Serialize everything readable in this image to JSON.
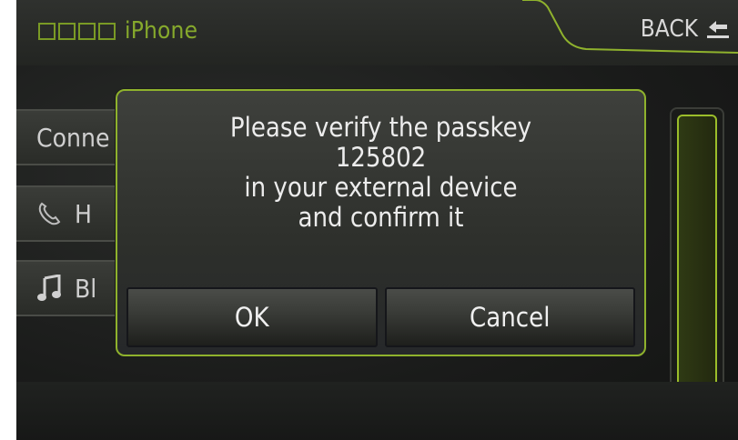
{
  "header": {
    "title": "iPhone",
    "back_label": "BACK"
  },
  "list": {
    "items": [
      {
        "label": "Conne",
        "icon": "none"
      },
      {
        "label": "H",
        "icon": "phone-icon"
      },
      {
        "label": "Bl",
        "icon": "music-note-icon"
      }
    ]
  },
  "dialog": {
    "lines": [
      "Please verify the passkey",
      "125802",
      "in your external device",
      "and confirm it"
    ],
    "ok_label": "OK",
    "cancel_label": "Cancel"
  },
  "colors": {
    "accent": "#8fb22d",
    "title": "#86a92c",
    "text": "#ececec",
    "background": "#1a1b1a"
  }
}
